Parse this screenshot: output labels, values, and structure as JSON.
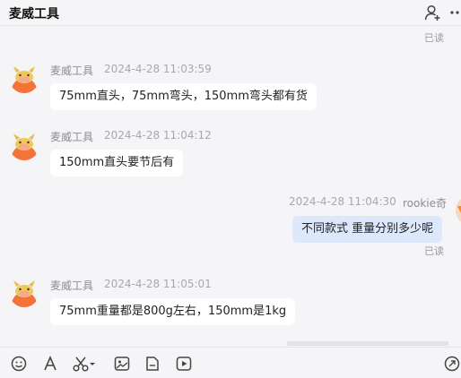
{
  "header": {
    "title": "麦威工具"
  },
  "messages": [
    {
      "read": "已读"
    },
    {
      "sender": "麦威工具",
      "time": "2024-4-28 11:03:59",
      "text": "75mm直头，75mm弯头，150mm弯头都有货"
    },
    {
      "sender": "麦威工具",
      "time": "2024-4-28 11:04:12",
      "text": "150mm直头要节后有"
    },
    {
      "sender": "rookie奇",
      "time": "2024-4-28 11:04:30",
      "text": "不同款式 重量分别多少呢",
      "read": "已读"
    },
    {
      "sender": "麦威工具",
      "time": "2024-4-28 11:05:01",
      "text": "75mm重量都是800g左右，150mm是1kg"
    }
  ],
  "icons": {
    "header": [
      "add-contact-icon",
      "more-icon"
    ],
    "toolbar": [
      "emoji-icon",
      "font-icon",
      "scissors-icon",
      "dropdown-icon",
      "image-icon",
      "file-icon",
      "video-icon",
      "quick-reply-icon"
    ]
  },
  "colors": {
    "my_bubble": "#dde8fb",
    "other_bubble": "#ffffff",
    "background": "#f5f5f7"
  }
}
